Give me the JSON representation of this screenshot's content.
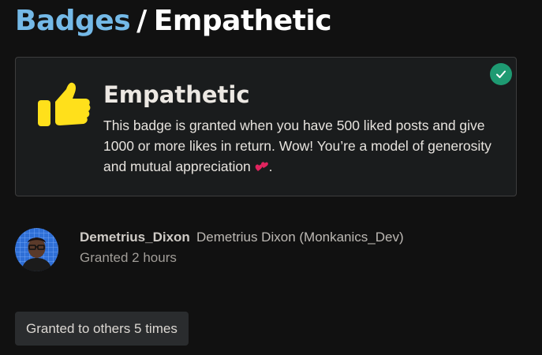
{
  "breadcrumb": {
    "link_label": "Badges",
    "separator": "/",
    "current": "Empathetic"
  },
  "badge": {
    "name": "Empathetic",
    "icon": "thumbs-up-icon",
    "icon_color": "#ffe01b",
    "description": "This badge is granted when you have 500 liked posts and give 1000 or more likes in return. Wow! You’re a model of generosity and mutual appreciation",
    "description_end": ".",
    "emoji": "two-hearts-icon",
    "granted": true,
    "granted_color": "#1e9a72"
  },
  "grant": {
    "username": "Demetrius_Dixon",
    "full_name": "Demetrius Dixon (Monkanics_Dev)",
    "granted_text": "Granted 2 hours"
  },
  "others_button": {
    "label": "Granted to others 5 times"
  },
  "colors": {
    "background": "#111111",
    "link": "#74b9e7",
    "card_border": "#3d3d3d"
  }
}
